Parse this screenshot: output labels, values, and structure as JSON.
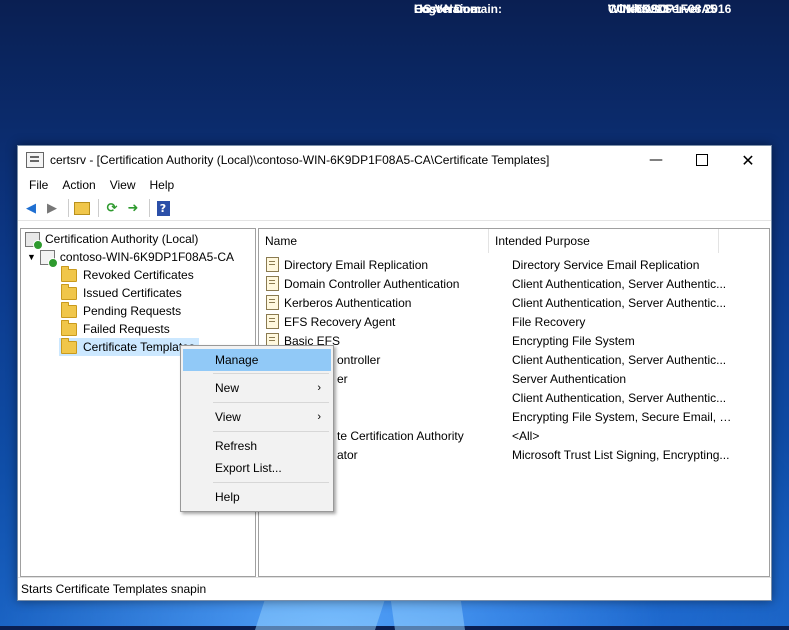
{
  "desktop": {
    "bginfo": [
      {
        "label": "Logon Domain:",
        "value": "CONTOSO"
      },
      {
        "label": "OS Version:",
        "value": "Windows Server 2016"
      },
      {
        "label": "Host Name:",
        "value": "WIN-6K9DP1F08A5"
      }
    ]
  },
  "window": {
    "title": "certsrv - [Certification Authority (Local)\\contoso-WIN-6K9DP1F08A5-CA\\Certificate Templates]",
    "minimize_icon": "minimize-icon",
    "maximize_icon": "maximize-icon",
    "close_icon": "close-icon"
  },
  "menubar": {
    "file": "File",
    "action": "Action",
    "view": "View",
    "help": "Help"
  },
  "toolbar": {
    "icons": [
      "back-icon",
      "forward-icon",
      "up-folder-icon",
      "refresh-icon",
      "export-list-icon",
      "help-icon"
    ]
  },
  "tree": {
    "root": "Certification Authority (Local)",
    "ca": "contoso-WIN-6K9DP1F08A5-CA",
    "items": [
      "Revoked Certificates",
      "Issued Certificates",
      "Pending Requests",
      "Failed Requests",
      "Certificate Templates"
    ]
  },
  "list": {
    "headers": {
      "name": "Name",
      "purpose": "Intended Purpose"
    },
    "rows": [
      {
        "name": "Directory Email Replication",
        "purpose": "Directory Service Email Replication"
      },
      {
        "name": "Domain Controller Authentication",
        "purpose": "Client Authentication, Server Authentic..."
      },
      {
        "name": "Kerberos Authentication",
        "purpose": "Client Authentication, Server Authentic..."
      },
      {
        "name": "EFS Recovery Agent",
        "purpose": "File Recovery"
      },
      {
        "name": "Basic EFS",
        "purpose": "Encrypting File System"
      },
      {
        "name": "ontroller",
        "purpose": "Client Authentication, Server Authentic..."
      },
      {
        "name": "er",
        "purpose": "Server Authentication"
      },
      {
        "name": "",
        "purpose": "Client Authentication, Server Authentic..."
      },
      {
        "name": "",
        "purpose": "Encrypting File System, Secure Email, Cl..."
      },
      {
        "name": "te Certification Authority",
        "purpose": "<All>"
      },
      {
        "name": "ator",
        "purpose": "Microsoft Trust List Signing, Encrypting..."
      }
    ]
  },
  "context_menu": {
    "manage": "Manage",
    "new": "New",
    "view": "View",
    "refresh": "Refresh",
    "export": "Export List...",
    "help": "Help",
    "submenu_arrow": "›"
  },
  "statusbar": {
    "text": "Starts Certificate Templates snapin"
  },
  "colors": {
    "menu_highlight": "#91c9f7",
    "tree_selection": "#cce8ff",
    "desktop": "#0c3a8c"
  }
}
